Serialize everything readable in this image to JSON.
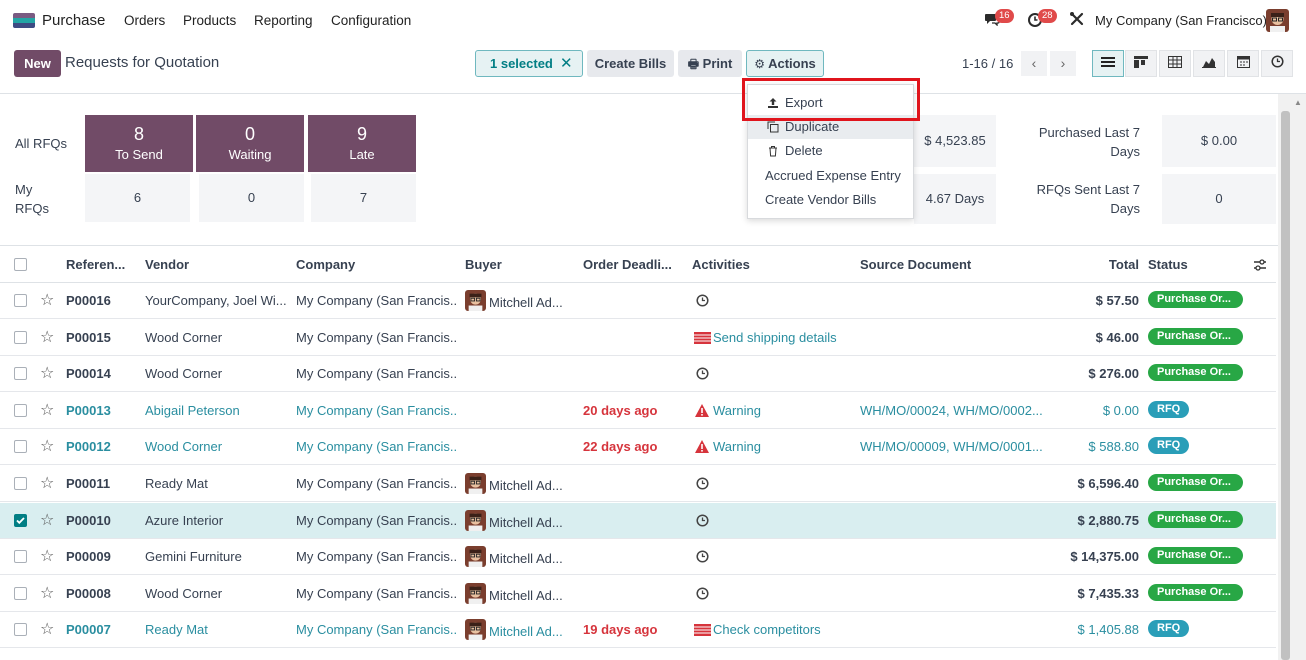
{
  "nav": {
    "app_name": "Purchase",
    "menu": [
      "Orders",
      "Products",
      "Reporting",
      "Configuration"
    ],
    "chat_badge": "16",
    "activity_badge": "28",
    "company": "My Company (San Francisco)"
  },
  "control": {
    "new_label": "New",
    "title": "Requests for Quotation",
    "selected_label": "1 selected",
    "create_bills_label": "Create Bills",
    "print_label": "Print",
    "actions_label": "Actions",
    "pager": "1-16 / 16"
  },
  "actions_menu": {
    "items": [
      "Export",
      "Duplicate",
      "Delete",
      "Accrued Expense Entry",
      "Create Vendor Bills"
    ]
  },
  "dashboard": {
    "all_rfqs_label": "All RFQs",
    "my_rfqs_label": "My RFQs",
    "tiles": [
      {
        "num": "8",
        "label": "To Send"
      },
      {
        "num": "0",
        "label": "Waiting"
      },
      {
        "num": "9",
        "label": "Late"
      }
    ],
    "my_values": [
      "6",
      "0",
      "7"
    ],
    "avg_order_value": "$ 4,523.85",
    "lead_time": "4.67 Days",
    "purchased_label": "Purchased Last 7 Days",
    "purchased_value": "$ 0.00",
    "rfqs_sent_label": "RFQs Sent Last 7 Days",
    "rfqs_sent_value": "0"
  },
  "table": {
    "headers": [
      "Referen...",
      "Vendor",
      "Company",
      "Buyer",
      "Order Deadli...",
      "Activities",
      "Source Document",
      "Total",
      "Status"
    ],
    "rows": [
      {
        "ref": "P00016",
        "vendor": "YourCompany, Joel Wi...",
        "company": "My Company (San Francis...",
        "buyer": "Mitchell Ad...",
        "deadline": "",
        "activity": "",
        "activity_type": "clock",
        "source": "",
        "total": "$ 57.50",
        "status": "Purchase Or...",
        "status_type": "po",
        "style": "normal",
        "checked": false
      },
      {
        "ref": "P00015",
        "vendor": "Wood Corner",
        "company": "My Company (San Francis...",
        "buyer": "",
        "deadline": "",
        "activity": "Send shipping details",
        "activity_type": "email",
        "source": "",
        "total": "$ 46.00",
        "status": "Purchase Or...",
        "status_type": "po",
        "style": "normal",
        "checked": false
      },
      {
        "ref": "P00014",
        "vendor": "Wood Corner",
        "company": "My Company (San Francis...",
        "buyer": "",
        "deadline": "",
        "activity": "",
        "activity_type": "clock",
        "source": "",
        "total": "$ 276.00",
        "status": "Purchase Or...",
        "status_type": "po",
        "style": "normal",
        "checked": false
      },
      {
        "ref": "P00013",
        "vendor": "Abigail Peterson",
        "company": "My Company (San Francis...",
        "buyer": "",
        "deadline": "20 days ago",
        "activity": "Warning",
        "activity_type": "warning",
        "source": "WH/MO/00024, WH/MO/0002...",
        "total": "$ 0.00",
        "status": "RFQ",
        "status_type": "rfq",
        "style": "teal",
        "checked": false
      },
      {
        "ref": "P00012",
        "vendor": "Wood Corner",
        "company": "My Company (San Francis...",
        "buyer": "",
        "deadline": "22 days ago",
        "activity": "Warning",
        "activity_type": "warning",
        "source": "WH/MO/00009, WH/MO/0001...",
        "total": "$ 588.80",
        "status": "RFQ",
        "status_type": "rfq",
        "style": "teal",
        "checked": false
      },
      {
        "ref": "P00011",
        "vendor": "Ready Mat",
        "company": "My Company (San Francis...",
        "buyer": "Mitchell Ad...",
        "deadline": "",
        "activity": "",
        "activity_type": "clock",
        "source": "",
        "total": "$ 6,596.40",
        "status": "Purchase Or...",
        "status_type": "po",
        "style": "normal",
        "checked": false
      },
      {
        "ref": "P00010",
        "vendor": "Azure Interior",
        "company": "My Company (San Francis...",
        "buyer": "Mitchell Ad...",
        "deadline": "",
        "activity": "",
        "activity_type": "clock",
        "source": "",
        "total": "$ 2,880.75",
        "status": "Purchase Or...",
        "status_type": "po",
        "style": "normal",
        "checked": true
      },
      {
        "ref": "P00009",
        "vendor": "Gemini Furniture",
        "company": "My Company (San Francis...",
        "buyer": "Mitchell Ad...",
        "deadline": "",
        "activity": "",
        "activity_type": "clock",
        "source": "",
        "total": "$ 14,375.00",
        "status": "Purchase Or...",
        "status_type": "po",
        "style": "normal",
        "checked": false
      },
      {
        "ref": "P00008",
        "vendor": "Wood Corner",
        "company": "My Company (San Francis...",
        "buyer": "Mitchell Ad...",
        "deadline": "",
        "activity": "",
        "activity_type": "clock",
        "source": "",
        "total": "$ 7,435.33",
        "status": "Purchase Or...",
        "status_type": "po",
        "style": "normal",
        "checked": false
      },
      {
        "ref": "P00007",
        "vendor": "Ready Mat",
        "company": "My Company (San Francis...",
        "buyer": "Mitchell Ad...",
        "deadline": "19 days ago",
        "activity": "Check competitors",
        "activity_type": "email",
        "source": "",
        "total": "$ 1,405.88",
        "status": "RFQ",
        "status_type": "rfq",
        "style": "teal",
        "checked": false
      }
    ]
  },
  "colors": {
    "brand": "#714b67",
    "teal": "#017e84",
    "success": "#28a745",
    "danger": "#d6343c"
  }
}
